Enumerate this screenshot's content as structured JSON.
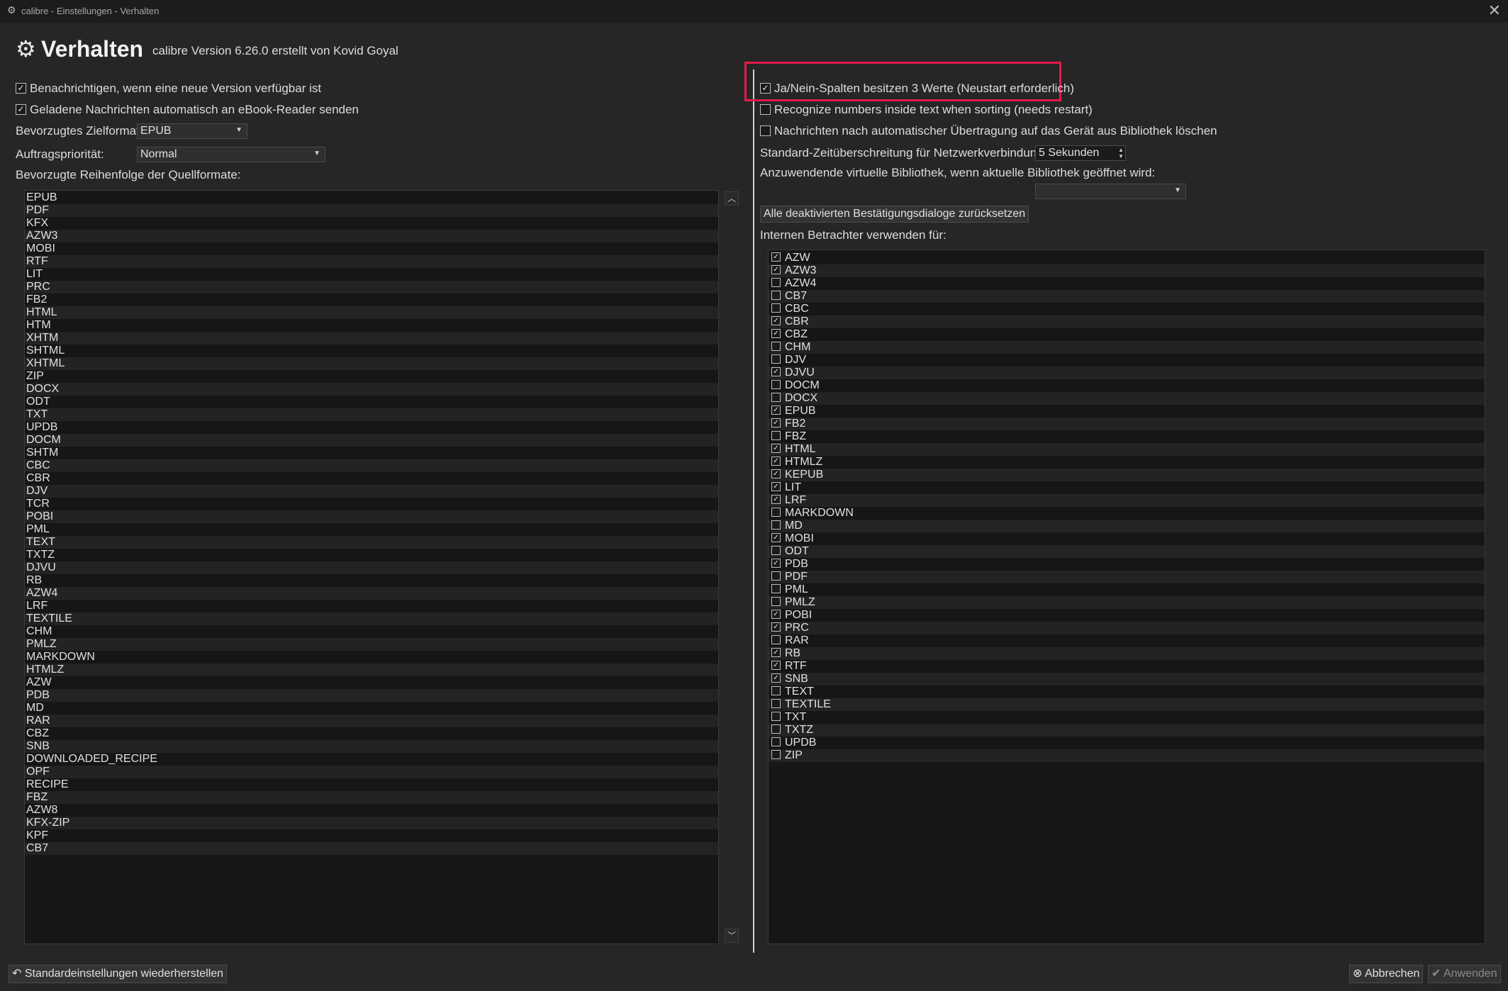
{
  "window": {
    "title": "calibre - Einstellungen - Verhalten",
    "close_glyph": "✕",
    "icon": "gear-icon"
  },
  "header": {
    "title": "Verhalten",
    "subtitle": "calibre Version 6.26.0 erstellt von Kovid Goyal"
  },
  "left": {
    "notify_new_version": {
      "label": "Benachrichtigen, wenn eine neue Version verfügbar ist",
      "checked": true
    },
    "auto_send_news": {
      "label": "Geladene Nachrichten automatisch an eBook-Reader senden",
      "checked": true
    },
    "output_format": {
      "label": "Bevorzugtes Zielformat:",
      "value": "EPUB"
    },
    "job_priority": {
      "label": "Auftragspriorität:",
      "value": "Normal"
    },
    "input_order_label": "Bevorzugte Reihenfolge der Quellformate:",
    "input_formats": [
      "EPUB",
      "PDF",
      "KFX",
      "AZW3",
      "MOBI",
      "RTF",
      "LIT",
      "PRC",
      "FB2",
      "HTML",
      "HTM",
      "XHTM",
      "SHTML",
      "XHTML",
      "ZIP",
      "DOCX",
      "ODT",
      "TXT",
      "UPDB",
      "DOCM",
      "SHTM",
      "CBC",
      "CBR",
      "DJV",
      "TCR",
      "POBI",
      "PML",
      "TEXT",
      "TXTZ",
      "DJVU",
      "RB",
      "AZW4",
      "LRF",
      "TEXTILE",
      "CHM",
      "PMLZ",
      "MARKDOWN",
      "HTMLZ",
      "AZW",
      "PDB",
      "MD",
      "RAR",
      "CBZ",
      "SNB",
      "DOWNLOADED_RECIPE",
      "OPF",
      "RECIPE",
      "FBZ",
      "AZW8",
      "KFX-ZIP",
      "KPF",
      "CB7"
    ],
    "move_up_glyph": "︿",
    "move_down_glyph": "﹀"
  },
  "right": {
    "bools_three_values": {
      "label": "Ja/Nein-Spalten besitzen 3 Werte (Neustart erforderlich)",
      "checked": true
    },
    "numeric_collation": {
      "label": "Recognize numbers inside text when sorting (needs restart)",
      "checked": false
    },
    "delete_news_after_send": {
      "label": "Nachrichten nach automatischer Übertragung auf das Gerät aus Bibliothek löschen",
      "checked": false
    },
    "network_timeout": {
      "label": "Standard-Zeitüberschreitung für Netzwerkverbindungen:",
      "value": "5 Sekunden"
    },
    "virtual_library": {
      "label": "Anzuwendende virtuelle Bibliothek, wenn aktuelle Bibliothek geöffnet wird:",
      "value": ""
    },
    "reset_confirm_button": "Alle deaktivierten Bestätigungsdialoge zurücksetzen",
    "internal_viewer_label": "Internen Betrachter verwenden für:",
    "viewer_formats": [
      {
        "name": "AZW",
        "checked": true
      },
      {
        "name": "AZW3",
        "checked": true
      },
      {
        "name": "AZW4",
        "checked": false
      },
      {
        "name": "CB7",
        "checked": false
      },
      {
        "name": "CBC",
        "checked": false
      },
      {
        "name": "CBR",
        "checked": true
      },
      {
        "name": "CBZ",
        "checked": true
      },
      {
        "name": "CHM",
        "checked": false
      },
      {
        "name": "DJV",
        "checked": false
      },
      {
        "name": "DJVU",
        "checked": true
      },
      {
        "name": "DOCM",
        "checked": false
      },
      {
        "name": "DOCX",
        "checked": false
      },
      {
        "name": "EPUB",
        "checked": true
      },
      {
        "name": "FB2",
        "checked": true
      },
      {
        "name": "FBZ",
        "checked": false
      },
      {
        "name": "HTML",
        "checked": true
      },
      {
        "name": "HTMLZ",
        "checked": true
      },
      {
        "name": "KEPUB",
        "checked": true
      },
      {
        "name": "LIT",
        "checked": true
      },
      {
        "name": "LRF",
        "checked": true
      },
      {
        "name": "MARKDOWN",
        "checked": false
      },
      {
        "name": "MD",
        "checked": false
      },
      {
        "name": "MOBI",
        "checked": true
      },
      {
        "name": "ODT",
        "checked": false
      },
      {
        "name": "PDB",
        "checked": true
      },
      {
        "name": "PDF",
        "checked": false
      },
      {
        "name": "PML",
        "checked": false
      },
      {
        "name": "PMLZ",
        "checked": false
      },
      {
        "name": "POBI",
        "checked": true
      },
      {
        "name": "PRC",
        "checked": true
      },
      {
        "name": "RAR",
        "checked": false
      },
      {
        "name": "RB",
        "checked": true
      },
      {
        "name": "RTF",
        "checked": true
      },
      {
        "name": "SNB",
        "checked": true
      },
      {
        "name": "TEXT",
        "checked": false
      },
      {
        "name": "TEXTILE",
        "checked": false
      },
      {
        "name": "TXT",
        "checked": false
      },
      {
        "name": "TXTZ",
        "checked": false
      },
      {
        "name": "UPDB",
        "checked": false
      },
      {
        "name": "ZIP",
        "checked": false
      }
    ]
  },
  "footer": {
    "restore_defaults": "Standardeinstellungen wiederherstellen",
    "cancel": "Abbrechen",
    "apply": "Anwenden"
  },
  "colors": {
    "highlight": "#e6194b",
    "background": "#262626"
  }
}
